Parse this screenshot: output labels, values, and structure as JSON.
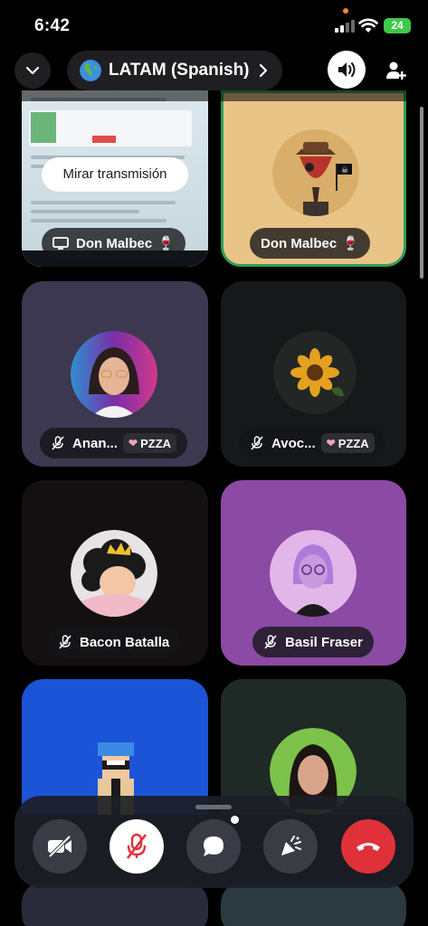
{
  "status_bar": {
    "time": "6:42",
    "battery": "24"
  },
  "header": {
    "channel_name": "LATAM (Spanish)",
    "channel_icon": "globe-americas-icon"
  },
  "tiles": [
    {
      "name": "Don Malbec",
      "emoji": "🍷",
      "type": "screen-share",
      "watch_label": "Mirar transmisión"
    },
    {
      "name": "Don Malbec",
      "emoji": "🍷",
      "type": "speaking-avatar"
    },
    {
      "name": "Anan...",
      "muted": true,
      "tag": "PZZA"
    },
    {
      "name": "Avoc...",
      "muted": true,
      "tag": "PZZA"
    },
    {
      "name": "Bacon Batalla",
      "muted": true
    },
    {
      "name": "Basil Fraser",
      "muted": true
    },
    {
      "name": ""
    },
    {
      "name": ""
    }
  ],
  "colors": {
    "end_call": "#e0313a",
    "speaking_ring": "#2f9e5a",
    "battery": "#3ec94a"
  }
}
